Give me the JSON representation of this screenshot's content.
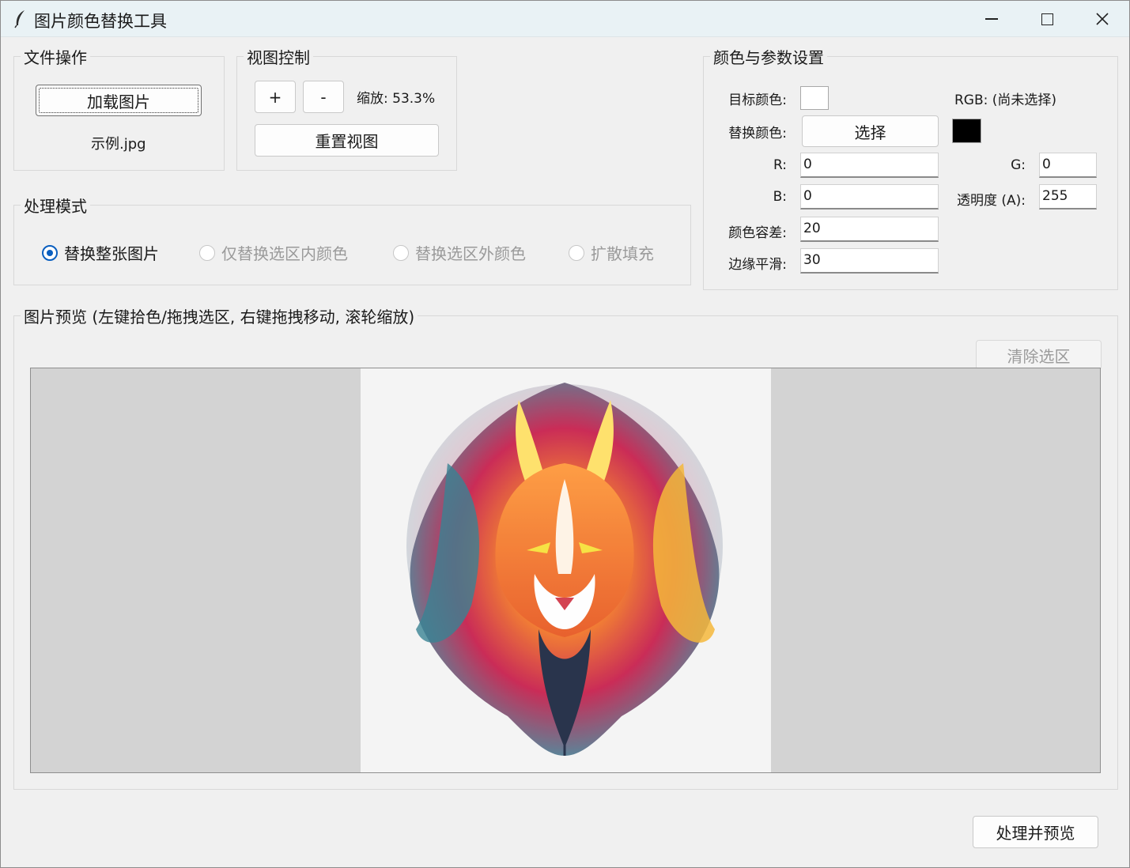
{
  "window": {
    "title": "图片颜色替换工具",
    "controls": {
      "minimize": "minimize",
      "maximize": "maximize",
      "close": "close"
    }
  },
  "file_ops": {
    "title": "文件操作",
    "load_button": "加载图片",
    "file_name": "示例.jpg"
  },
  "view_control": {
    "title": "视图控制",
    "zoom_in": "+",
    "zoom_out": "-",
    "zoom_label": "缩放: 53.3%",
    "reset_button": "重置视图"
  },
  "mode": {
    "title": "处理模式",
    "options": [
      {
        "label": "替换整张图片",
        "selected": true,
        "enabled": true
      },
      {
        "label": "仅替换选区内颜色",
        "selected": false,
        "enabled": false
      },
      {
        "label": "替换选区外颜色",
        "selected": false,
        "enabled": false
      },
      {
        "label": "扩散填充",
        "selected": false,
        "enabled": false
      }
    ]
  },
  "settings": {
    "title": "颜色与参数设置",
    "target_color_label": "目标颜色:",
    "target_color": "#ffffff",
    "rgb_info": "RGB: (尚未选择)",
    "replace_color_label": "替换颜色:",
    "select_button": "选择",
    "replace_color": "#000000",
    "r_label": "R:",
    "r_value": "0",
    "g_label": "G:",
    "g_value": "0",
    "b_label": "B:",
    "b_value": "0",
    "alpha_label": "透明度 (A):",
    "alpha_value": "255",
    "tolerance_label": "颜色容差:",
    "tolerance_value": "20",
    "smooth_label": "边缘平滑:",
    "smooth_value": "30"
  },
  "preview": {
    "title": "图片预览 (左键拾色/拖拽选区, 右键拖拽移动, 滚轮缩放)",
    "clear_button": "清除选区",
    "canvas_bg": "#d3d3d3",
    "image_bg": "#f4f4f4"
  },
  "footer": {
    "process_button": "处理并预览"
  },
  "colors": {
    "titlebar": "#e9f2f5",
    "window_bg": "#f0f0f0",
    "accent": "#0a5fbf"
  }
}
